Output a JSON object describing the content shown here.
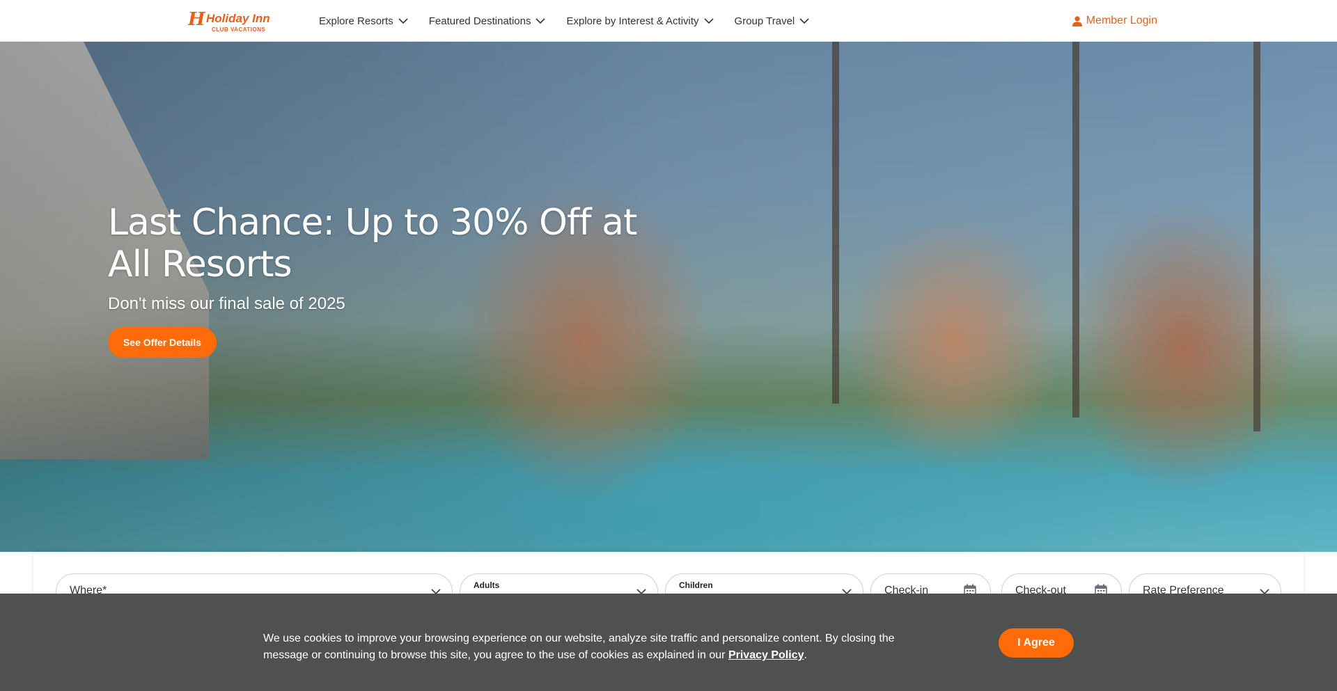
{
  "brand": {
    "logo_text": "Holiday Inn",
    "logo_subtext": "CLUB VACATIONS",
    "accent_color": "#e8601c",
    "button_color": "#ff6b08"
  },
  "nav": {
    "items": [
      {
        "label": "Explore Resorts",
        "icon": "chevron-down-icon"
      },
      {
        "label": "Featured Destinations",
        "icon": "chevron-down-icon"
      },
      {
        "label": "Explore by Interest & Activity",
        "icon": "chevron-down-icon"
      },
      {
        "label": "Group Travel",
        "icon": "chevron-down-icon"
      }
    ],
    "member_login": {
      "label": "Member Login",
      "icon": "user-icon"
    }
  },
  "hero": {
    "title": "Last Chance: Up to  30% Off at All Resorts",
    "subtitle": "Don't miss our final sale of 2025",
    "cta_label": "See Offer Details"
  },
  "booking": {
    "where": {
      "placeholder": "Where*",
      "icon": "chevron-down-icon"
    },
    "adults": {
      "label": "Adults",
      "icon": "chevron-down-icon"
    },
    "children": {
      "label": "Children",
      "icon": "chevron-down-icon"
    },
    "checkin": {
      "placeholder": "Check-in",
      "icon": "calendar-icon"
    },
    "checkout": {
      "placeholder": "Check-out",
      "icon": "calendar-icon"
    },
    "rate": {
      "placeholder": "Rate Preference",
      "icon": "chevron-down-icon"
    }
  },
  "cookie": {
    "text": "We use cookies to improve your browsing experience on our website, analyze site traffic and personalize content. By closing the message or continuing to browse this site, you agree to the use of cookies as explained in our ",
    "link_label": "Privacy Policy",
    "text_end": ".",
    "agree_label": "I Agree"
  }
}
